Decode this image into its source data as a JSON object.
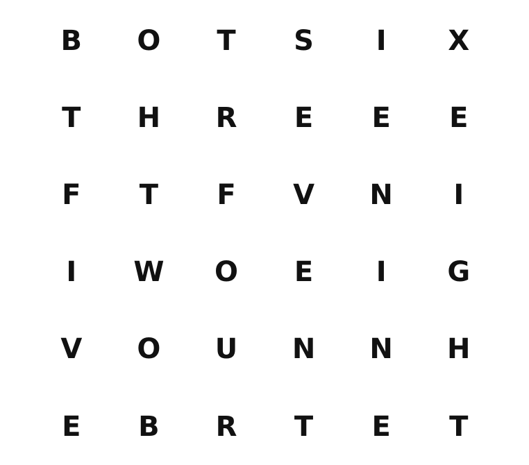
{
  "word_search": {
    "grid": [
      [
        "B",
        "O",
        "T",
        "S",
        "I",
        "X"
      ],
      [
        "T",
        "H",
        "R",
        "E",
        "E",
        "E"
      ],
      [
        "F",
        "T",
        "F",
        "V",
        "N",
        "I"
      ],
      [
        "I",
        "W",
        "O",
        "E",
        "I",
        "G"
      ],
      [
        "V",
        "O",
        "U",
        "N",
        "N",
        "H"
      ],
      [
        "E",
        "B",
        "R",
        "T",
        "E",
        "T"
      ]
    ]
  }
}
